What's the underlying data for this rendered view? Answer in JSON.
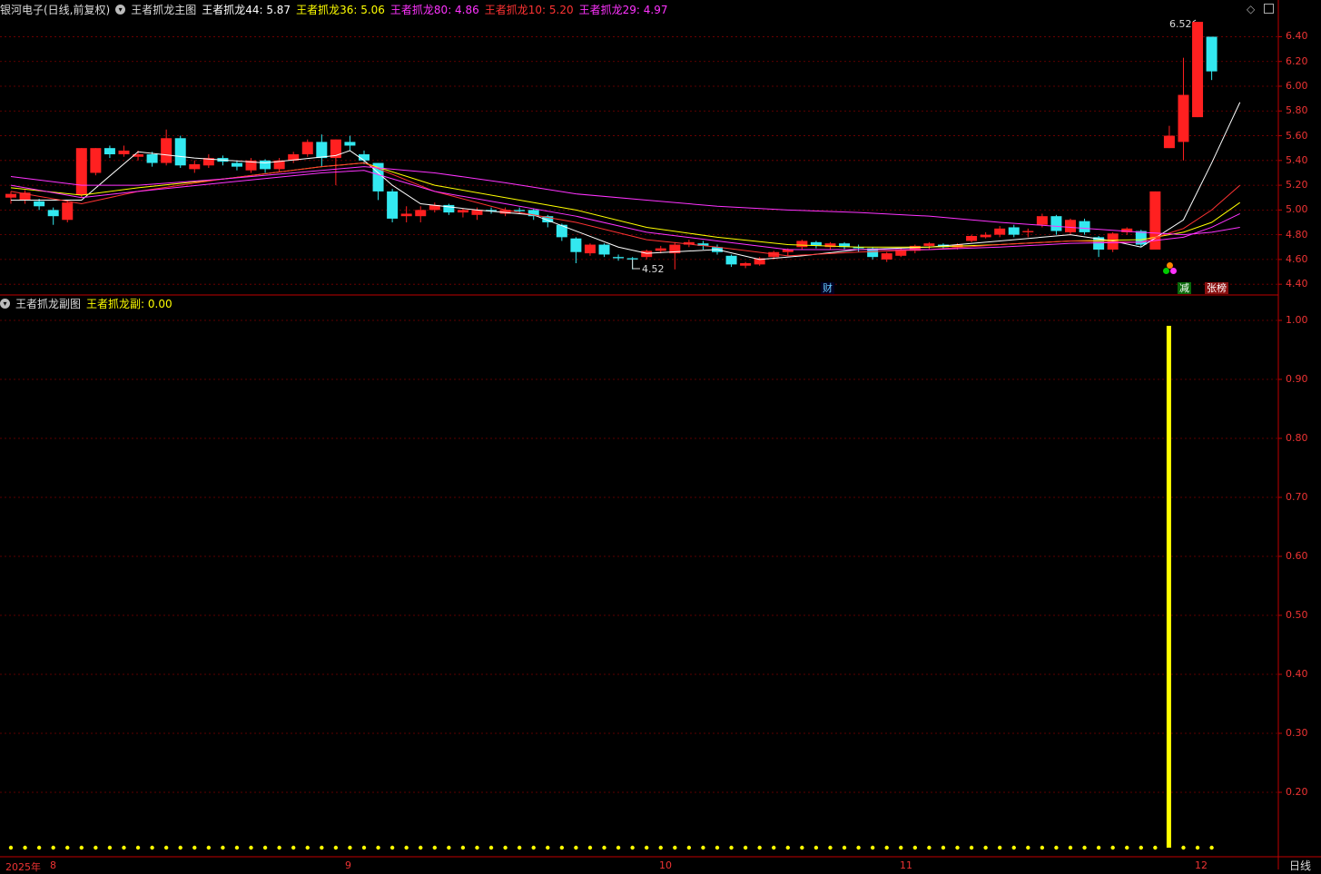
{
  "main_header": {
    "stock": "银河电子(日线,前复权)",
    "indicator": "王者抓龙主图",
    "items": [
      {
        "label": "王者抓龙44: 5.87",
        "color": "#ffffff"
      },
      {
        "label": "王者抓龙36: 5.06",
        "color": "#ffff00"
      },
      {
        "label": "王者抓龙80: 4.86",
        "color": "#ff33ff"
      },
      {
        "label": "王者抓龙10: 5.20",
        "color": "#ff3333"
      },
      {
        "label": "王者抓龙29: 4.97",
        "color": "#ff33ff"
      }
    ]
  },
  "sub_header": {
    "indicator": "王者抓龙副图",
    "items": [
      {
        "label": "王者抓龙副: 0.00",
        "color": "#ffff00"
      }
    ]
  },
  "main_axis": [
    "6.40",
    "6.20",
    "6.00",
    "5.80",
    "5.60",
    "5.40",
    "5.20",
    "5.00",
    "4.80",
    "4.60",
    "4.40"
  ],
  "sub_axis": [
    "1.00",
    "0.90",
    "0.80",
    "0.70",
    "0.60",
    "0.50",
    "0.40",
    "0.30",
    "0.20"
  ],
  "x_axis": [
    "2025年",
    "8",
    "9",
    "10",
    "11",
    "12"
  ],
  "period_label": "日线",
  "annotations": {
    "high": "6.52",
    "low": "4.52"
  },
  "badges": {
    "cai": "财",
    "jian": "减",
    "zhangbang": "张榜"
  },
  "colors": {
    "up": "#ff2020",
    "down": "#33e8f0",
    "grid": "#7a0000",
    "axis": "#c00000",
    "bar": "#ffff00"
  },
  "chart_data": {
    "type": "candlestick",
    "ylim": [
      4.35,
      6.55
    ],
    "candles": [
      [
        5.1,
        5.13,
        5.15,
        5.05
      ],
      [
        5.08,
        5.14,
        5.16,
        5.05
      ],
      [
        5.07,
        5.03,
        5.09,
        5.0
      ],
      [
        5.0,
        4.95,
        5.02,
        4.88
      ],
      [
        4.92,
        5.06,
        5.08,
        4.9
      ],
      [
        5.12,
        5.5,
        5.5,
        5.1
      ],
      [
        5.3,
        5.5,
        5.5,
        5.28
      ],
      [
        5.5,
        5.45,
        5.52,
        5.42
      ],
      [
        5.45,
        5.48,
        5.52,
        5.43
      ],
      [
        5.43,
        5.45,
        5.48,
        5.4
      ],
      [
        5.45,
        5.38,
        5.47,
        5.35
      ],
      [
        5.38,
        5.58,
        5.65,
        5.36
      ],
      [
        5.58,
        5.36,
        5.6,
        5.34
      ],
      [
        5.33,
        5.37,
        5.4,
        5.3
      ],
      [
        5.36,
        5.42,
        5.45,
        5.34
      ],
      [
        5.42,
        5.39,
        5.44,
        5.36
      ],
      [
        5.38,
        5.35,
        5.4,
        5.32
      ],
      [
        5.32,
        5.4,
        5.42,
        5.3
      ],
      [
        5.4,
        5.33,
        5.41,
        5.3
      ],
      [
        5.33,
        5.4,
        5.42,
        5.31
      ],
      [
        5.4,
        5.45,
        5.47,
        5.38
      ],
      [
        5.45,
        5.55,
        5.57,
        5.43
      ],
      [
        5.55,
        5.42,
        5.61,
        5.35
      ],
      [
        5.42,
        5.57,
        5.57,
        5.2
      ],
      [
        5.55,
        5.52,
        5.6,
        5.48
      ],
      [
        5.45,
        5.4,
        5.48,
        5.37
      ],
      [
        5.38,
        5.15,
        5.38,
        5.08
      ],
      [
        5.15,
        4.93,
        5.17,
        4.9
      ],
      [
        4.95,
        4.97,
        5.03,
        4.9
      ],
      [
        4.95,
        5.0,
        5.03,
        4.9
      ],
      [
        5.0,
        5.04,
        5.06,
        4.98
      ],
      [
        5.04,
        4.98,
        5.05,
        4.96
      ],
      [
        4.98,
        5.0,
        5.01,
        4.94
      ],
      [
        4.96,
        5.0,
        5.02,
        4.92
      ],
      [
        5.0,
        4.99,
        5.02,
        4.97
      ],
      [
        4.97,
        5.0,
        5.02,
        4.95
      ],
      [
        5.0,
        4.99,
        5.02,
        4.97
      ],
      [
        5.0,
        4.95,
        5.01,
        4.92
      ],
      [
        4.95,
        4.9,
        4.96,
        4.86
      ],
      [
        4.88,
        4.78,
        4.89,
        4.75
      ],
      [
        4.77,
        4.66,
        4.78,
        4.57
      ],
      [
        4.65,
        4.72,
        4.73,
        4.63
      ],
      [
        4.72,
        4.64,
        4.73,
        4.62
      ],
      [
        4.62,
        4.61,
        4.64,
        4.59
      ],
      [
        4.61,
        4.6,
        4.62,
        4.52
      ],
      [
        4.62,
        4.67,
        4.68,
        4.6
      ],
      [
        4.67,
        4.69,
        4.71,
        4.65
      ],
      [
        4.65,
        4.72,
        4.74,
        4.52
      ],
      [
        4.72,
        4.74,
        4.76,
        4.7
      ],
      [
        4.73,
        4.71,
        4.75,
        4.68
      ],
      [
        4.7,
        4.66,
        4.72,
        4.64
      ],
      [
        4.63,
        4.56,
        4.64,
        4.54
      ],
      [
        4.55,
        4.57,
        4.58,
        4.53
      ],
      [
        4.56,
        4.61,
        4.62,
        4.55
      ],
      [
        4.62,
        4.66,
        4.67,
        4.6
      ],
      [
        4.66,
        4.68,
        4.69,
        4.63
      ],
      [
        4.7,
        4.75,
        4.76,
        4.68
      ],
      [
        4.74,
        4.71,
        4.75,
        4.69
      ],
      [
        4.7,
        4.73,
        4.74,
        4.68
      ],
      [
        4.73,
        4.7,
        4.74,
        4.68
      ],
      [
        4.7,
        4.69,
        4.72,
        4.66
      ],
      [
        4.69,
        4.62,
        4.7,
        4.6
      ],
      [
        4.6,
        4.65,
        4.66,
        4.58
      ],
      [
        4.63,
        4.68,
        4.69,
        4.62
      ],
      [
        4.67,
        4.71,
        4.72,
        4.65
      ],
      [
        4.71,
        4.73,
        4.74,
        4.68
      ],
      [
        4.72,
        4.7,
        4.73,
        4.69
      ],
      [
        4.7,
        4.72,
        4.73,
        4.68
      ],
      [
        4.75,
        4.79,
        4.8,
        4.74
      ],
      [
        4.78,
        4.8,
        4.82,
        4.77
      ],
      [
        4.8,
        4.85,
        4.87,
        4.78
      ],
      [
        4.86,
        4.8,
        4.88,
        4.78
      ],
      [
        4.82,
        4.83,
        4.85,
        4.78
      ],
      [
        4.88,
        4.95,
        4.97,
        4.86
      ],
      [
        4.95,
        4.83,
        4.96,
        4.8
      ],
      [
        4.82,
        4.92,
        4.93,
        4.8
      ],
      [
        4.91,
        4.82,
        4.93,
        4.8
      ],
      [
        4.78,
        4.68,
        4.79,
        4.62
      ],
      [
        4.68,
        4.81,
        4.82,
        4.66
      ],
      [
        4.82,
        4.85,
        4.86,
        4.8
      ],
      [
        4.83,
        4.72,
        4.84,
        4.7
      ],
      [
        4.68,
        5.15,
        5.15,
        4.68
      ],
      [
        5.5,
        5.6,
        5.68,
        5.5
      ],
      [
        5.55,
        5.93,
        6.23,
        5.4
      ],
      [
        5.75,
        6.52,
        6.52,
        5.75
      ],
      [
        6.4,
        6.12,
        6.4,
        6.05
      ]
    ],
    "ma": [
      {
        "name": "王者抓龙44",
        "color": "#ffffff",
        "values": [
          [
            0,
            5.08
          ],
          [
            5,
            5.08
          ],
          [
            9,
            5.47
          ],
          [
            13,
            5.42
          ],
          [
            18,
            5.38
          ],
          [
            23,
            5.44
          ],
          [
            24,
            5.48
          ],
          [
            25,
            5.4
          ],
          [
            27,
            5.2
          ],
          [
            29,
            5.05
          ],
          [
            33,
            5.0
          ],
          [
            37,
            4.96
          ],
          [
            40,
            4.83
          ],
          [
            43,
            4.7
          ],
          [
            45,
            4.65
          ],
          [
            50,
            4.68
          ],
          [
            53,
            4.6
          ],
          [
            56,
            4.63
          ],
          [
            60,
            4.68
          ],
          [
            65,
            4.7
          ],
          [
            70,
            4.75
          ],
          [
            75,
            4.8
          ],
          [
            78,
            4.75
          ],
          [
            80,
            4.7
          ],
          [
            83,
            4.92
          ],
          [
            85,
            5.38
          ],
          [
            87,
            5.87
          ]
        ]
      },
      {
        "name": "王者抓龙36",
        "color": "#ffff00",
        "values": [
          [
            0,
            5.18
          ],
          [
            5,
            5.12
          ],
          [
            9,
            5.18
          ],
          [
            15,
            5.25
          ],
          [
            22,
            5.35
          ],
          [
            25,
            5.38
          ],
          [
            30,
            5.2
          ],
          [
            35,
            5.1
          ],
          [
            40,
            5.0
          ],
          [
            45,
            4.86
          ],
          [
            50,
            4.78
          ],
          [
            55,
            4.72
          ],
          [
            60,
            4.7
          ],
          [
            65,
            4.7
          ],
          [
            70,
            4.72
          ],
          [
            75,
            4.75
          ],
          [
            80,
            4.76
          ],
          [
            83,
            4.82
          ],
          [
            85,
            4.9
          ],
          [
            87,
            5.06
          ]
        ]
      },
      {
        "name": "王者抓龙10",
        "color": "#ff3333",
        "values": [
          [
            0,
            5.15
          ],
          [
            5,
            5.05
          ],
          [
            9,
            5.15
          ],
          [
            15,
            5.25
          ],
          [
            22,
            5.35
          ],
          [
            25,
            5.38
          ],
          [
            30,
            5.15
          ],
          [
            35,
            5.0
          ],
          [
            40,
            4.9
          ],
          [
            45,
            4.76
          ],
          [
            50,
            4.7
          ],
          [
            55,
            4.63
          ],
          [
            60,
            4.66
          ],
          [
            65,
            4.68
          ],
          [
            70,
            4.72
          ],
          [
            75,
            4.75
          ],
          [
            80,
            4.74
          ],
          [
            83,
            4.85
          ],
          [
            85,
            5.0
          ],
          [
            87,
            5.2
          ]
        ]
      },
      {
        "name": "王者抓龙80",
        "color": "#ff33ff",
        "values": [
          [
            0,
            5.27
          ],
          [
            5,
            5.2
          ],
          [
            9,
            5.2
          ],
          [
            15,
            5.25
          ],
          [
            22,
            5.32
          ],
          [
            25,
            5.35
          ],
          [
            30,
            5.3
          ],
          [
            35,
            5.22
          ],
          [
            40,
            5.13
          ],
          [
            45,
            5.08
          ],
          [
            50,
            5.03
          ],
          [
            55,
            5.0
          ],
          [
            60,
            4.98
          ],
          [
            65,
            4.95
          ],
          [
            70,
            4.9
          ],
          [
            75,
            4.86
          ],
          [
            80,
            4.82
          ],
          [
            83,
            4.8
          ],
          [
            85,
            4.82
          ],
          [
            87,
            4.86
          ]
        ]
      },
      {
        "name": "王者抓龙29",
        "color": "#ff33ff",
        "values": [
          [
            0,
            5.2
          ],
          [
            5,
            5.1
          ],
          [
            9,
            5.15
          ],
          [
            15,
            5.22
          ],
          [
            22,
            5.3
          ],
          [
            25,
            5.32
          ],
          [
            30,
            5.15
          ],
          [
            35,
            5.05
          ],
          [
            40,
            4.95
          ],
          [
            45,
            4.82
          ],
          [
            50,
            4.75
          ],
          [
            55,
            4.68
          ],
          [
            60,
            4.68
          ],
          [
            65,
            4.68
          ],
          [
            70,
            4.7
          ],
          [
            75,
            4.73
          ],
          [
            80,
            4.74
          ],
          [
            83,
            4.78
          ],
          [
            85,
            4.86
          ],
          [
            87,
            4.97
          ]
        ]
      }
    ],
    "sub": {
      "ylim": [
        0.1,
        1.02
      ],
      "signal_index": 82,
      "signal_value": 1.0
    }
  }
}
